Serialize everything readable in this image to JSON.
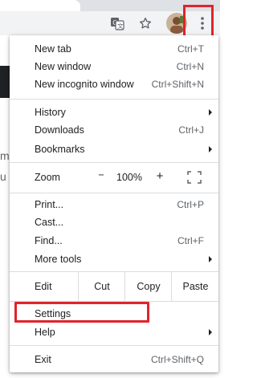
{
  "toolbar": {
    "icons": [
      "translate-icon",
      "star-icon",
      "avatar",
      "more-vert-icon"
    ],
    "highlight_color": "#e0242b"
  },
  "page_fragments": [
    "m",
    "u"
  ],
  "menu": {
    "group1": [
      {
        "label": "New tab",
        "shortcut": "Ctrl+T"
      },
      {
        "label": "New window",
        "shortcut": "Ctrl+N"
      },
      {
        "label": "New incognito window",
        "shortcut": "Ctrl+Shift+N"
      }
    ],
    "group2": [
      {
        "label": "History",
        "submenu": true
      },
      {
        "label": "Downloads",
        "shortcut": "Ctrl+J"
      },
      {
        "label": "Bookmarks",
        "submenu": true
      }
    ],
    "zoom": {
      "label": "Zoom",
      "minus": "−",
      "value": "100%",
      "plus": "+"
    },
    "group3": [
      {
        "label": "Print...",
        "shortcut": "Ctrl+P"
      },
      {
        "label": "Cast..."
      },
      {
        "label": "Find...",
        "shortcut": "Ctrl+F"
      },
      {
        "label": "More tools",
        "submenu": true
      }
    ],
    "edit": {
      "label": "Edit",
      "cut": "Cut",
      "copy": "Copy",
      "paste": "Paste"
    },
    "group4": [
      {
        "label": "Settings"
      },
      {
        "label": "Help",
        "submenu": true
      }
    ],
    "group5": [
      {
        "label": "Exit",
        "shortcut": "Ctrl+Shift+Q"
      }
    ]
  }
}
